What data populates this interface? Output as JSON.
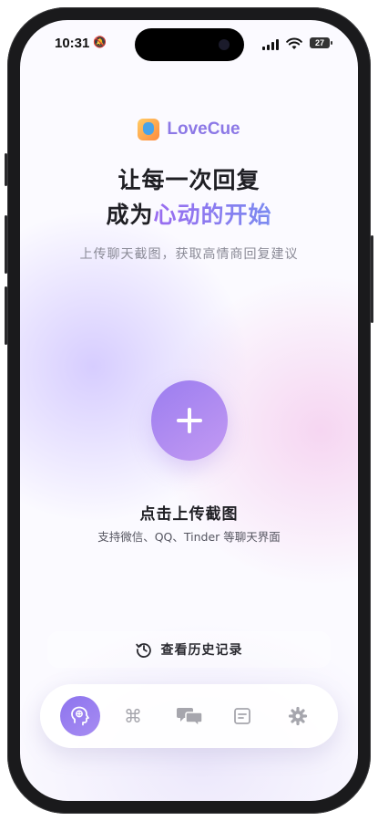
{
  "status_bar": {
    "time": "10:31",
    "battery": "27"
  },
  "brand": {
    "name": "LoveCue"
  },
  "hero": {
    "line1": "让每一次回复",
    "line2_prefix": "成为",
    "line2_accent": "心动的开始",
    "subtitle": "上传聊天截图，获取高情商回复建议"
  },
  "upload": {
    "title": "点击上传截图",
    "hint": "支持微信、QQ、Tinder 等聊天界面"
  },
  "history": {
    "label": "查看历史记录"
  },
  "tab_bar": {
    "active_tab": "brain-icon",
    "tabs": [
      "brain-icon",
      "command-icon",
      "chat-bubbles-icon",
      "card-icon",
      "gear-icon"
    ]
  },
  "colors": {
    "accent": "#8c78e6",
    "accent_gradient_start": "#9b7df0",
    "accent_gradient_end": "#c39af2",
    "text_primary": "#1f1f24",
    "text_secondary": "#8a8a96"
  }
}
